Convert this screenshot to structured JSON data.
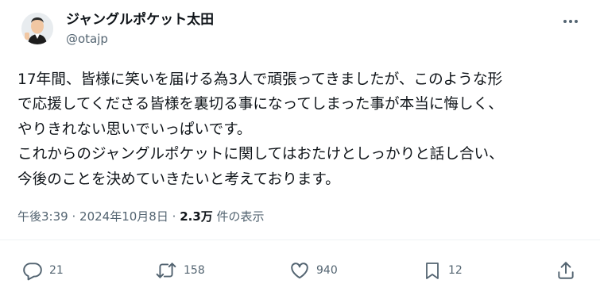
{
  "user": {
    "display_name": "ジャングルポケット太田",
    "handle": "@otajp"
  },
  "tweet": {
    "lines": [
      "17年間、皆様に笑いを届ける為3人で頑張ってきましたが、このような形",
      "で応援してくださる皆様を裏切る事になってしまった事が本当に悔しく、",
      "やりきれない思いでいっぱいです。",
      "これからのジャングルポケットに関してはおたけとしっかりと話し合い、",
      "今後のことを決めていきたいと考えております。"
    ]
  },
  "meta": {
    "time": "午後3:39",
    "separator": "·",
    "date": "2024年10月8日",
    "views_count": "2.3万",
    "views_label": "件の表示"
  },
  "actions": {
    "replies": "21",
    "reposts": "158",
    "likes": "940",
    "bookmarks": "12"
  },
  "icons": {
    "avatar": "avatar",
    "more": "more-icon",
    "reply": "reply-icon",
    "repost": "repost-icon",
    "like": "heart-icon",
    "bookmark": "bookmark-icon",
    "share": "share-icon"
  },
  "colors": {
    "text": "#0f1419",
    "secondary": "#536471",
    "divider": "#eff3f4"
  }
}
